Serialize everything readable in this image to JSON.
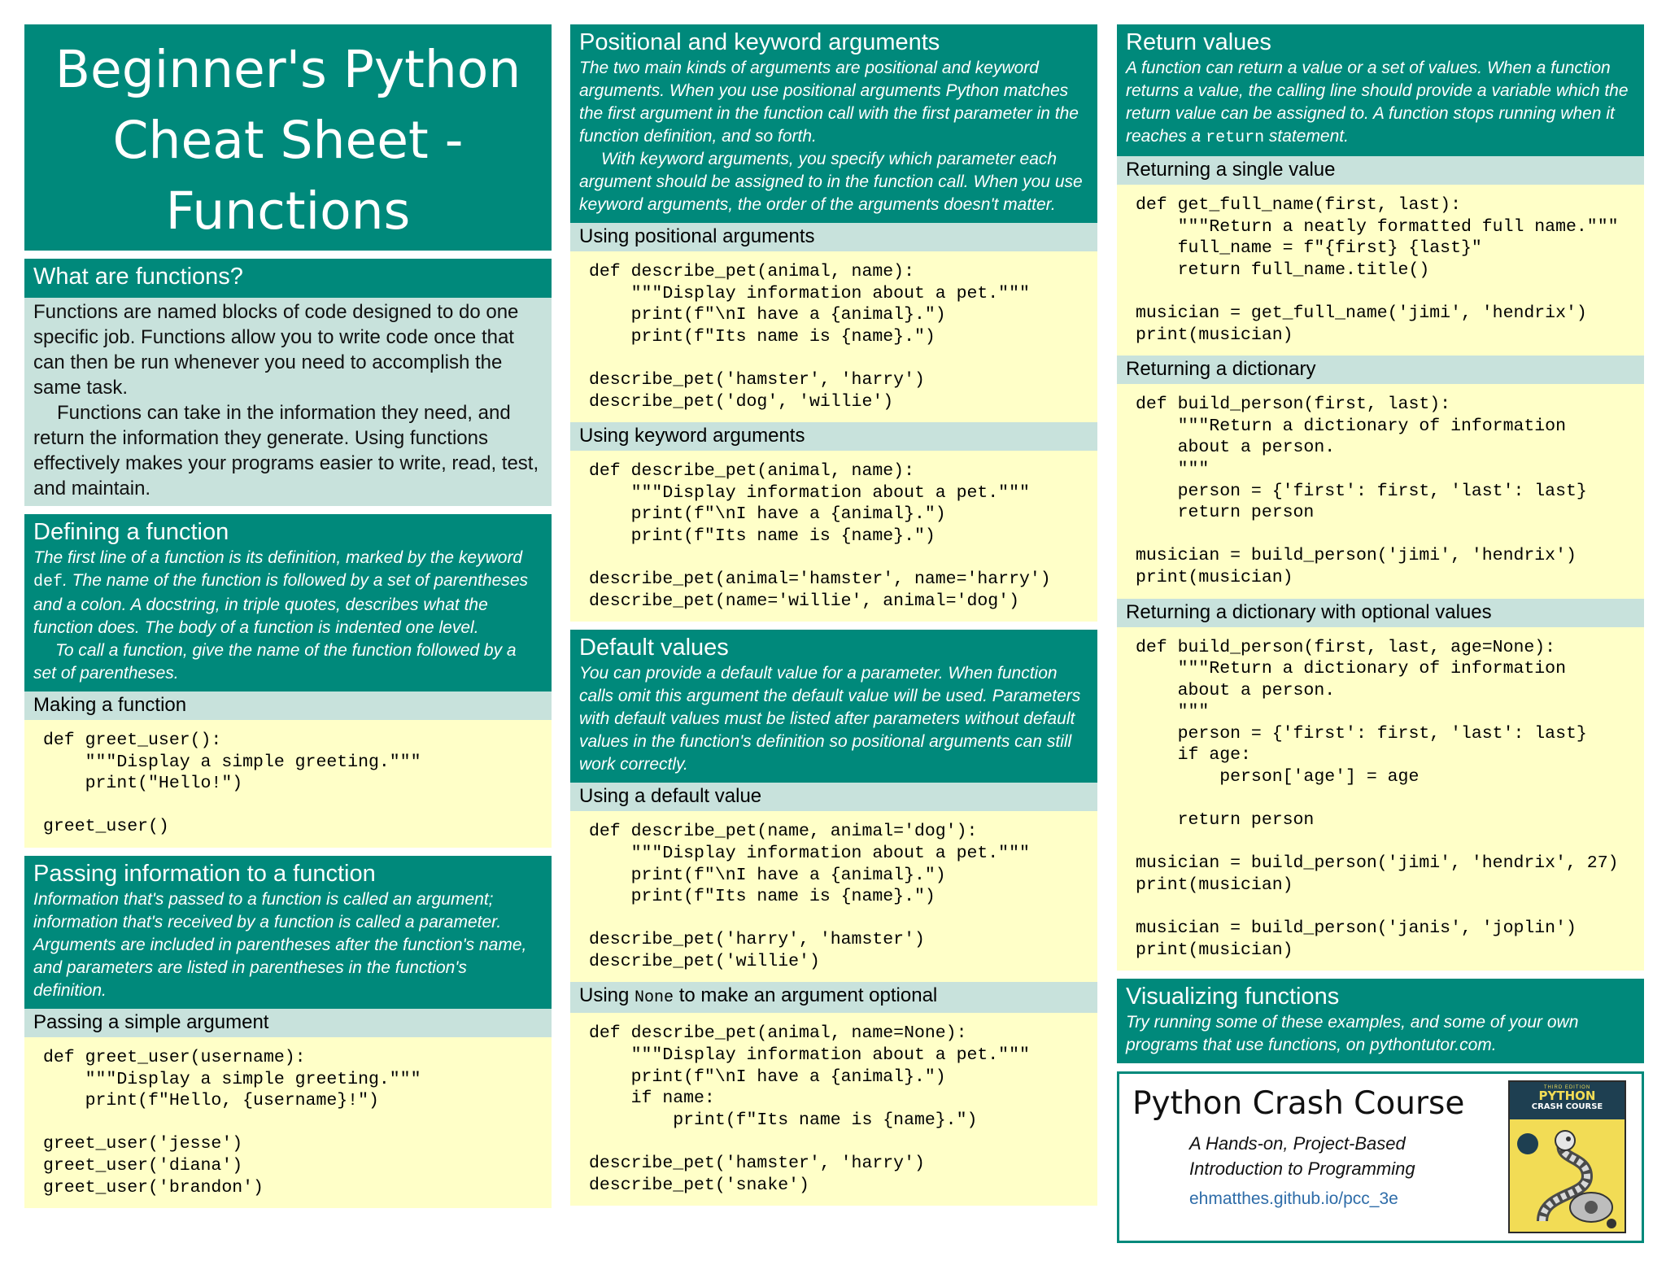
{
  "title_lines": [
    "Beginner's Python",
    "Cheat Sheet -",
    "Functions"
  ],
  "what": {
    "title": "What are functions?",
    "p1": "Functions are named blocks of code designed to do one specific job. Functions allow you to write code once that can then be run whenever you need to accomplish the same task.",
    "p2": "Functions can take in the information they need, and return the information they generate. Using functions effectively makes your programs easier to write, read, test, and maintain."
  },
  "defining": {
    "title": "Defining a function",
    "p1_a": "The first line of a function is its definition, marked by the keyword ",
    "p1_code": "def",
    "p1_b": ". The name of the function is followed by a set of parentheses and a colon. A docstring, in triple quotes, describes what the function does. The body of a function is indented one level.",
    "p2": "To call a function, give the name of the function followed by a set of parentheses.",
    "sub": "Making a function",
    "code": "def greet_user():\n    \"\"\"Display a simple greeting.\"\"\"\n    print(\"Hello!\")\n\ngreet_user()"
  },
  "passing": {
    "title": "Passing information to a function",
    "p1": "Information that's passed to a function is called an argument; information that's received by a function is called a parameter. Arguments are included in parentheses after the function's name, and parameters are listed in parentheses in the function's definition.",
    "sub": "Passing a simple argument",
    "code": "def greet_user(username):\n    \"\"\"Display a simple greeting.\"\"\"\n    print(f\"Hello, {username}!\")\n\ngreet_user('jesse')\ngreet_user('diana')\ngreet_user('brandon')"
  },
  "positional": {
    "title": "Positional and keyword arguments",
    "p1": "The two main kinds of arguments are positional and keyword arguments. When you use positional arguments Python matches the first argument in the function call with the first parameter in the function definition, and so forth.",
    "p2": "With keyword arguments, you specify which parameter each argument should be assigned to in the function call. When you use keyword arguments, the order of the arguments doesn't matter.",
    "sub1": "Using positional arguments",
    "code1": "def describe_pet(animal, name):\n    \"\"\"Display information about a pet.\"\"\"\n    print(f\"\\nI have a {animal}.\")\n    print(f\"Its name is {name}.\")\n\ndescribe_pet('hamster', 'harry')\ndescribe_pet('dog', 'willie')",
    "sub2": "Using keyword arguments",
    "code2": "def describe_pet(animal, name):\n    \"\"\"Display information about a pet.\"\"\"\n    print(f\"\\nI have a {animal}.\")\n    print(f\"Its name is {name}.\")\n\ndescribe_pet(animal='hamster', name='harry')\ndescribe_pet(name='willie', animal='dog')"
  },
  "defaults": {
    "title": "Default values",
    "p1": "You can provide a default value for a parameter. When function calls omit this argument the default value will be used. Parameters with default values must be listed after parameters without default values in the function's definition so positional arguments can still work correctly.",
    "sub1": "Using a default value",
    "code1": "def describe_pet(name, animal='dog'):\n    \"\"\"Display information about a pet.\"\"\"\n    print(f\"\\nI have a {animal}.\")\n    print(f\"Its name is {name}.\")\n\ndescribe_pet('harry', 'hamster')\ndescribe_pet('willie')",
    "sub2_a": "Using ",
    "sub2_code": "None",
    "sub2_b": " to make an argument optional",
    "code2": "def describe_pet(animal, name=None):\n    \"\"\"Display information about a pet.\"\"\"\n    print(f\"\\nI have a {animal}.\")\n    if name:\n        print(f\"Its name is {name}.\")\n\ndescribe_pet('hamster', 'harry')\ndescribe_pet('snake')"
  },
  "returns": {
    "title": "Return values",
    "p1_a": "A function can return a value or a set of values. When a function returns a value, the calling line should provide a variable which the return value can be assigned to. A function stops running when it reaches a ",
    "p1_code": "return",
    "p1_b": " statement.",
    "sub1": "Returning a single value",
    "code1": "def get_full_name(first, last):\n    \"\"\"Return a neatly formatted full name.\"\"\"\n    full_name = f\"{first} {last}\"\n    return full_name.title()\n\nmusician = get_full_name('jimi', 'hendrix')\nprint(musician)",
    "sub2": "Returning a dictionary",
    "code2": "def build_person(first, last):\n    \"\"\"Return a dictionary of information\n    about a person.\n    \"\"\"\n    person = {'first': first, 'last': last}\n    return person\n\nmusician = build_person('jimi', 'hendrix')\nprint(musician)",
    "sub3": "Returning a dictionary with optional values",
    "code3": "def build_person(first, last, age=None):\n    \"\"\"Return a dictionary of information\n    about a person.\n    \"\"\"\n    person = {'first': first, 'last': last}\n    if age:\n        person['age'] = age\n\n    return person\n\nmusician = build_person('jimi', 'hendrix', 27)\nprint(musician)\n\nmusician = build_person('janis', 'joplin')\nprint(musician)"
  },
  "visualizing": {
    "title": "Visualizing functions",
    "p1": "Try running some of these examples, and some of your own programs that use functions, on pythontutor.com."
  },
  "book": {
    "name": "Python Crash Course",
    "sub_lines": [
      "A Hands-on, Project-Based",
      "Introduction to Programming"
    ],
    "link": "ehmatthes.github.io/pcc_3e",
    "cover_edition": "THIRD EDITION",
    "cover_title": "PYTHON",
    "cover_title2": "CRASH COURSE"
  },
  "colors": {
    "header": "#00897b",
    "subheader": "#c8e2dc",
    "code_bg": "#ffffc8",
    "link": "#2e6ca8",
    "cover": "#f2dc55"
  }
}
